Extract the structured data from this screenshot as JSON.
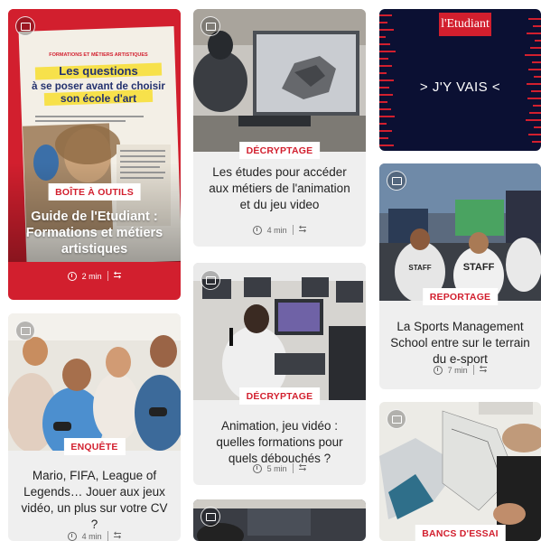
{
  "cards": [
    {
      "tag": "Boîte à outils",
      "title": "Guide de l'Etudiant : Formations et métiers artistiques",
      "read_time": "2 min",
      "magazine": {
        "kicker": "FORMATIONS ET MÉTIERS ARTISTIQUES",
        "headline_1": "Les questions",
        "headline_2": "à se poser avant de choisir",
        "headline_3": "son école d'art"
      }
    },
    {
      "tag": "Décryptage",
      "title": "Les études pour accéder aux métiers de l'animation et du jeu video",
      "read_time": "4 min"
    },
    {
      "brand": "l'Etudiant",
      "slogan": "> J'Y VAIS <"
    },
    {
      "tag": "Reportage",
      "title": "La Sports Management School entre sur le terrain du e-sport",
      "read_time": "7 min",
      "jersey": "STAFF"
    },
    {
      "tag": "Décryptage",
      "title": "Animation, jeu vidéo : quelles formations pour quels débouchés ?",
      "read_time": "5 min"
    },
    {
      "tag": "Enquête",
      "title": "Mario, FIFA, League of Legends… Jouer aux jeux vidéo, un plus sur votre CV ?",
      "read_time": "4 min"
    },
    {
      "tag": "Bancs d'essai"
    }
  ]
}
